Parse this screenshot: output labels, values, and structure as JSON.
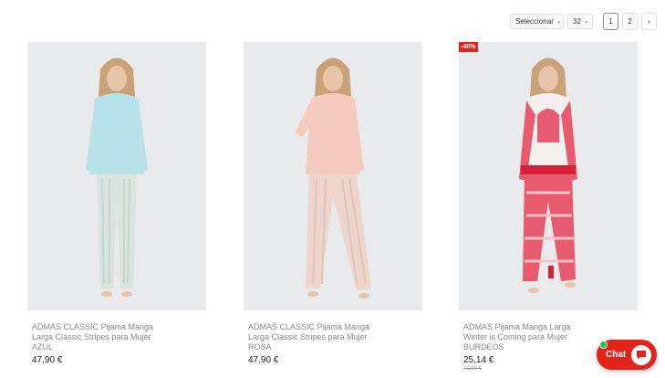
{
  "toolbar": {
    "sort_value": "Seleccionar",
    "per_page_value": "32",
    "pages": [
      "1",
      "2"
    ],
    "current_page": "1"
  },
  "products": [
    {
      "name": "ADMAS CLASSIC Pijama Manga Larga Classic Stripes para Mujer AZUL",
      "price": "47,90 €",
      "top_color": "#b8e3ea",
      "bottom_color": "#d9e4df"
    },
    {
      "name": "ADMAS CLASSIC Pijama Manga Larga Classic Stripes para Mujer ROSA",
      "price": "47,90 €",
      "top_color": "#f5cbbf",
      "bottom_color": "#eed6cc"
    },
    {
      "name": "ADMAS Pijama Manga Larga Winter is Coming para Mujer BURDEOS",
      "price": "25,14 €",
      "old_price": "41,90 €",
      "badge": "-40%",
      "top_color": "#f4f0ee",
      "bottom_color": "#e85a6e"
    }
  ],
  "chat": {
    "label": "Chat",
    "color": "#e2231a",
    "online_color": "#2fbf3a"
  }
}
